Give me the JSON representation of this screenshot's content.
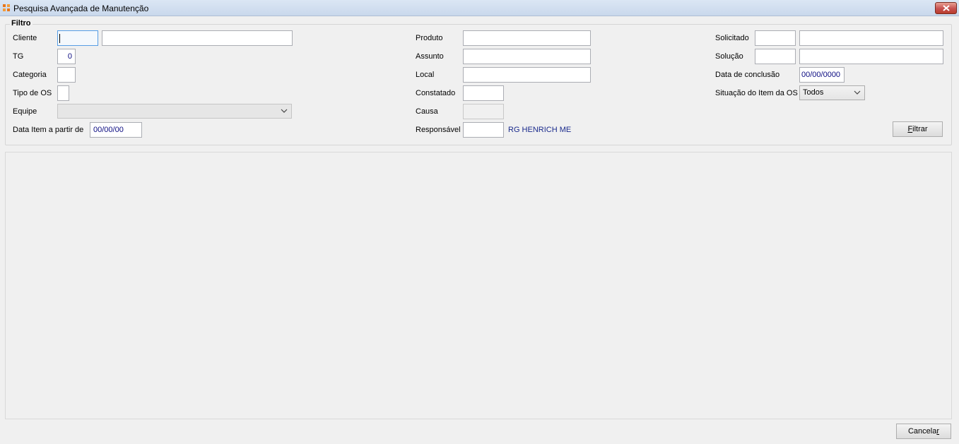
{
  "window": {
    "title": "Pesquisa Avançada de Manutenção"
  },
  "filter": {
    "group_title": "Filtro",
    "cliente_label": "Cliente",
    "cliente_code": "",
    "cliente_name": "",
    "tg_label": "TG",
    "tg_value": "0",
    "categoria_label": "Categoria",
    "categoria_value": "",
    "tipo_os_label": "Tipo de OS",
    "tipo_os_value": "",
    "equipe_label": "Equipe",
    "equipe_value": "",
    "data_item_label": "Data Item a partir de",
    "data_item_value": "00/00/00",
    "produto_label": "Produto",
    "produto_value": "",
    "assunto_label": "Assunto",
    "assunto_value": "",
    "local_label": "Local",
    "local_value": "",
    "constatado_label": "Constatado",
    "constatado_value": "",
    "causa_label": "Causa",
    "causa_value": "",
    "responsavel_label": "Responsável",
    "responsavel_code": "",
    "responsavel_name": "RG HENRICH ME",
    "solicitado_label": "Solicitado",
    "solicitado_code": "",
    "solicitado_name": "",
    "solucao_label": "Solução",
    "solucao_code": "",
    "solucao_name": "",
    "data_conclusao_label": "Data de conclusão",
    "data_conclusao_value": "00/00/0000",
    "situacao_label": "Situação do Item da OS",
    "situacao_value": "Todos",
    "filtrar_first": "F",
    "filtrar_rest": "iltrar"
  },
  "footer": {
    "cancelar_main": "Cancela",
    "cancelar_underlined": "r"
  },
  "colors": {
    "accent": "#569de5",
    "link": "#1a2a8c",
    "close": "#c75050"
  }
}
